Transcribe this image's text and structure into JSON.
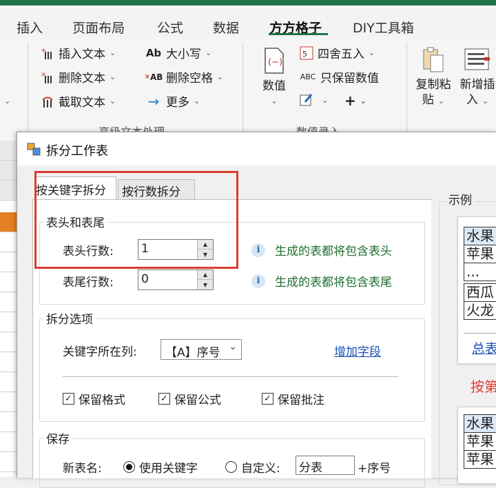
{
  "ribbon": {
    "tabs": [
      "插入",
      "页面布局",
      "公式",
      "数据",
      "方方格子",
      "DIY工具箱"
    ],
    "active_tab": "方方格子",
    "text_group": {
      "insert_text": "插入文本",
      "delete_text": "删除文本",
      "extract_text": "截取文本",
      "case": "大小写",
      "delete_spaces": "删除空格",
      "more": "更多",
      "label": "高级文本处理"
    },
    "number_group": {
      "value_button": "数值",
      "round": "四舍五入",
      "keep_numbers": "只保留数值",
      "label": "数值录入"
    },
    "copy_paste": [
      "复制粘",
      "贴"
    ],
    "insert_new": [
      "新增插",
      "入"
    ],
    "chevron": "⌄",
    "plus": "+"
  },
  "dialog": {
    "title": "拆分工作表",
    "tabs": [
      "按关键字拆分",
      "按行数拆分"
    ],
    "header_footer": {
      "legend": "表头和表尾",
      "header_rows_label": "表头行数:",
      "header_rows_value": "1",
      "footer_rows_label": "表尾行数:",
      "footer_rows_value": "0",
      "header_hint": "生成的表都将包含表头",
      "footer_hint": "生成的表都将包含表尾"
    },
    "split_options": {
      "legend": "拆分选项",
      "key_column_label": "关键字所在列:",
      "key_column_value": "【A】序号",
      "add_field_link": "增加字段",
      "keep_format": "保留格式",
      "keep_formula": "保留公式",
      "keep_comment": "保留批注"
    },
    "save": {
      "legend": "保存",
      "new_name_label": "新表名:",
      "use_keyword": "使用关键字",
      "custom": "自定义:",
      "custom_value": "分表",
      "suffix": "+序号"
    },
    "example": {
      "legend": "示例",
      "table1": [
        "水果",
        "苹果",
        "...",
        "西瓜",
        "火龙"
      ],
      "total_link": "总表",
      "split_label": "按第",
      "table2": [
        "水果",
        "苹果",
        "苹果"
      ]
    }
  },
  "colors": {
    "excel_green": "#217346",
    "highlight_box": "#e03a2f",
    "hint_green": "#1e6e2e",
    "link_blue": "#1a4fb3",
    "cell_orange": "#e67e22"
  }
}
